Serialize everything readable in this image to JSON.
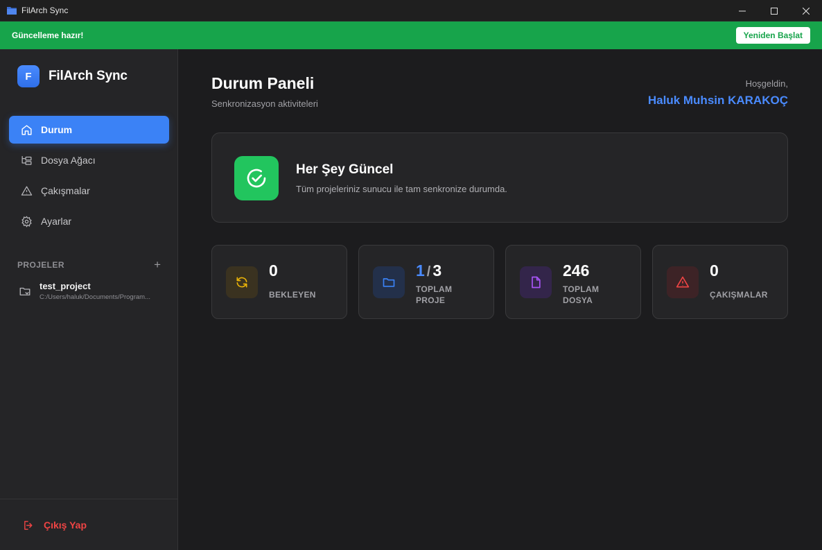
{
  "window": {
    "title": "FilArch Sync"
  },
  "banner": {
    "message": "Güncelleme hazır!",
    "restart_label": "Yeniden Başlat"
  },
  "sidebar": {
    "logo_letter": "F",
    "brand_name": "FilArch Sync",
    "nav": [
      {
        "label": "Durum",
        "icon": "home-icon",
        "active": true
      },
      {
        "label": "Dosya Ağacı",
        "icon": "folder-tree-icon",
        "active": false
      },
      {
        "label": "Çakışmalar",
        "icon": "warning-triangle-icon",
        "active": false
      },
      {
        "label": "Ayarlar",
        "icon": "gear-icon",
        "active": false
      }
    ],
    "projects_header": "PROJELER",
    "projects": [
      {
        "name": "test_project",
        "path": "C:/Users/haluk/Documents/Program..."
      }
    ],
    "logout_label": "Çıkış Yap"
  },
  "main": {
    "title": "Durum Paneli",
    "subtitle": "Senkronizasyon aktiviteleri",
    "welcome": "Hoşgeldin,",
    "username": "Haluk Muhsin KARAKOÇ",
    "status": {
      "title": "Her Şey Güncel",
      "description": "Tüm projeleriniz sunucu ile tam senkronize durumda."
    },
    "stats": [
      {
        "value": "0",
        "label": "BEKLEYEN",
        "icon": "sync-icon",
        "color": "#eab308"
      },
      {
        "value_active": "1",
        "value_total": "3",
        "label_line1": "TOPLAM",
        "label_line2": "PROJE",
        "icon": "folder-icon",
        "color": "#3b82f6"
      },
      {
        "value": "246",
        "label_line1": "TOPLAM",
        "label_line2": "DOSYA",
        "icon": "file-icon",
        "color": "#a855f7"
      },
      {
        "value": "0",
        "label": "ÇAKIŞMALAR",
        "icon": "alert-icon",
        "color": "#ef4444"
      }
    ]
  },
  "colors": {
    "accent": "#3b82f6",
    "success": "#22c55e",
    "banner": "#17a44b",
    "danger": "#ef4444"
  }
}
